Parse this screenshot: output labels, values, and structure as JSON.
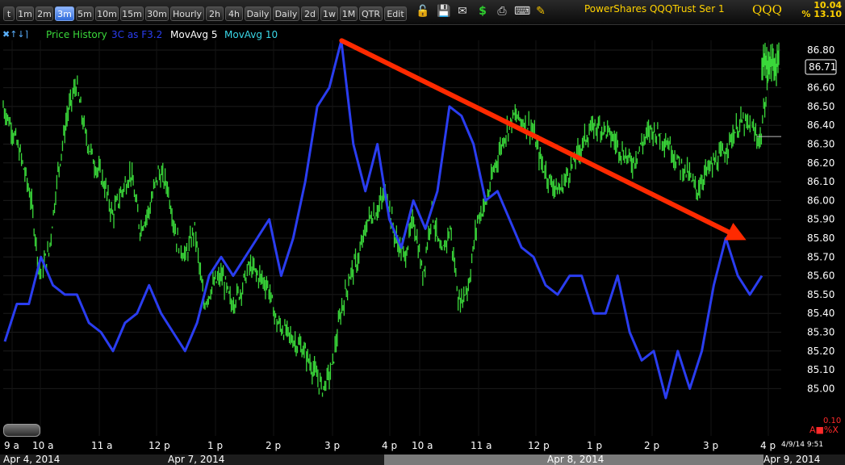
{
  "toolbar": {
    "timeframes": [
      "t",
      "1m",
      "2m",
      "3m",
      "5m",
      "10m",
      "15m",
      "30m",
      "Hourly",
      "2h",
      "4h",
      "Daily",
      "Daily",
      "2d",
      "1w",
      "1M",
      "QTR",
      "Edit"
    ],
    "active": "3m",
    "title": "PowerShares QQQTrust Ser 1",
    "symbol": "QQQ",
    "change_abs": "10.04",
    "change_pct": "% 13.10"
  },
  "legend": {
    "controls": "✖↑↓⌉",
    "items": [
      {
        "label": "Price History",
        "color": "#3ad83a"
      },
      {
        "label": "3C as F3.2",
        "color": "#2a3df0"
      },
      {
        "label": "MovAvg 5",
        "color": "#ffffff"
      },
      {
        "label": "MovAvg 10",
        "color": "#3ad8e8"
      }
    ]
  },
  "status": {
    "timestamp": "4/9/14 9:51",
    "scale_value": "0.10",
    "scale_buttons": "A■%X"
  },
  "chart_data": {
    "type": "line",
    "ylim": [
      84.9,
      86.9
    ],
    "y_ticks": [
      "86.80",
      "86.70",
      "86.60",
      "86.50",
      "86.40",
      "86.30",
      "86.20",
      "86.10",
      "86.00",
      "85.90",
      "85.80",
      "85.70",
      "85.60",
      "85.50",
      "85.40",
      "85.30",
      "85.20",
      "85.10",
      "85.00"
    ],
    "last_price": "86.71",
    "x_tick_labels": [
      "9 a",
      "10 a",
      "11 a",
      "12 p",
      "1 p",
      "2 p",
      "3 p",
      "4 p",
      "10 a",
      "11 a",
      "12 p",
      "1 p",
      "2 p",
      "3 p",
      "4 p"
    ],
    "date_labels": [
      "Apr 4, 2014",
      "Apr 7, 2014",
      "Apr 8, 2014",
      "Apr 9, 2014"
    ],
    "series": [
      {
        "name": "Price History",
        "color": "#3ad83a",
        "values": [
          86.5,
          86.38,
          86.22,
          86.02,
          85.62,
          85.72,
          86.15,
          86.45,
          86.62,
          86.35,
          86.2,
          86.1,
          85.92,
          86.05,
          86.15,
          85.85,
          85.95,
          86.15,
          86.08,
          85.8,
          85.7,
          85.85,
          85.45,
          85.55,
          85.6,
          85.45,
          85.52,
          85.65,
          85.6,
          85.55,
          85.35,
          85.3,
          85.25,
          85.2,
          85.1,
          85.0,
          85.1,
          85.4,
          85.6,
          85.7,
          85.9,
          85.95,
          86.05,
          85.8,
          85.7,
          85.9,
          85.6,
          85.95,
          85.7,
          85.85,
          85.45,
          85.55,
          85.9,
          86.0,
          86.2,
          86.35,
          86.45,
          86.42,
          86.38,
          86.2,
          86.1,
          86.05,
          86.15,
          86.25,
          86.35,
          86.4,
          86.38,
          86.32,
          86.25,
          86.2,
          86.3,
          86.38,
          86.35,
          86.3,
          86.2,
          86.15,
          86.05,
          86.15,
          86.2,
          86.25,
          86.35,
          86.42,
          86.38,
          86.32,
          86.7
        ]
      },
      {
        "name": "3C as F3.2",
        "color": "#2a3df0",
        "values": [
          85.25,
          85.45,
          85.45,
          85.7,
          85.55,
          85.5,
          85.5,
          85.35,
          85.3,
          85.2,
          85.35,
          85.4,
          85.55,
          85.4,
          85.3,
          85.2,
          85.35,
          85.6,
          85.7,
          85.6,
          85.7,
          85.8,
          85.9,
          85.6,
          85.8,
          86.1,
          86.5,
          86.6,
          86.85,
          86.3,
          86.05,
          86.3,
          85.9,
          85.75,
          86.0,
          85.85,
          86.05,
          86.5,
          86.45,
          86.3,
          86.0,
          86.05,
          85.9,
          85.75,
          85.7,
          85.55,
          85.5,
          85.6,
          85.6,
          85.4,
          85.4,
          85.6,
          85.3,
          85.15,
          85.2,
          84.95,
          85.2,
          85.0,
          85.2,
          85.55,
          85.8,
          85.6,
          85.5,
          85.6
        ]
      }
    ],
    "annotation": {
      "type": "arrow",
      "color": "#ff2a00",
      "from": [
        0.435,
        86.85
      ],
      "to": [
        0.955,
        85.79
      ]
    }
  }
}
